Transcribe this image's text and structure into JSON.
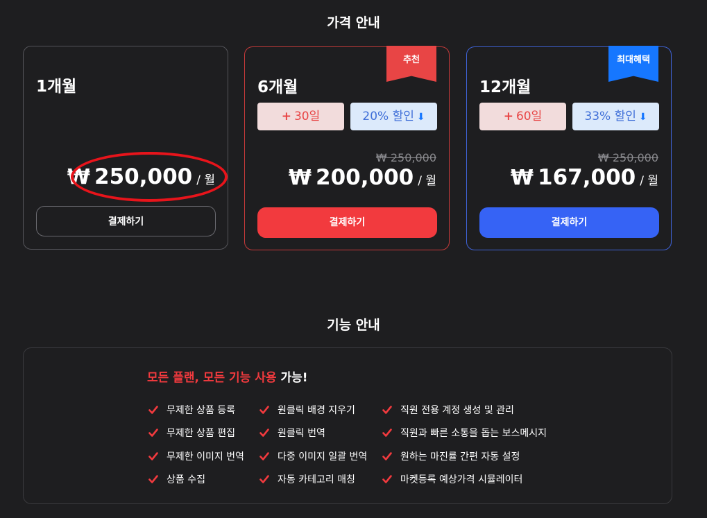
{
  "pricing": {
    "title": "가격 안내",
    "plans": [
      {
        "name": "1개월",
        "price_currency": "₩",
        "price_amount": "250,000",
        "per": "/ 월",
        "button": "결제하기"
      },
      {
        "name": "6개월",
        "ribbon": "추천",
        "ribbon_color": "#e84545",
        "bonus_days": "30일",
        "discount": "20% 할인",
        "old_price": "₩ 250,000",
        "price_currency": "₩",
        "price_amount": "200,000",
        "per": "/ 월",
        "button": "결제하기",
        "accent_color": "#f23a3e"
      },
      {
        "name": "12개월",
        "ribbon": "최대혜택",
        "ribbon_color": "#1677ff",
        "bonus_days": "60일",
        "discount": "33% 할인",
        "old_price": "₩ 250,000",
        "price_currency": "₩",
        "price_amount": "167,000",
        "per": "/ 월",
        "button": "결제하기",
        "accent_color": "#3663f5"
      }
    ]
  },
  "features": {
    "title": "기능 안내",
    "headline_red": "모든 플랜, 모든 기능 사용",
    "headline_white": " 가능!",
    "columns": [
      [
        "무제한 상품 등록",
        "무제한 상품 편집",
        "무제한 이미지 번역",
        "상품 수집"
      ],
      [
        "원클릭 배경 지우기",
        "원클릭 번역",
        "다중 이미지 일괄 번역",
        "자동 카테고리 매칭"
      ],
      [
        "직원 전용 계정 생성 및 관리",
        "직원과 빠른 소통을 돕는 보스메시지",
        "원하는 마진률 간편 자동 설정",
        "마켓등록 예상가격 시뮬레이터"
      ]
    ]
  },
  "colors": {
    "background": "#1e1e20",
    "red": "#f23a3e",
    "blue": "#3663f5"
  }
}
